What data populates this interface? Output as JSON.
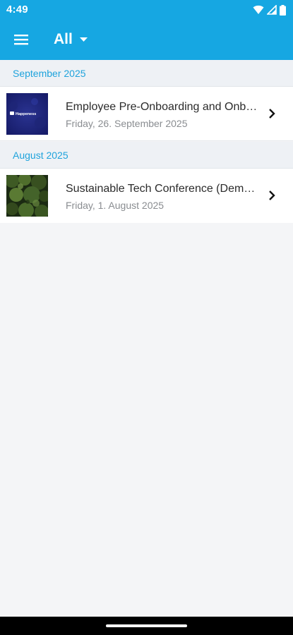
{
  "status_bar": {
    "time": "4:49",
    "icons": [
      "wifi-icon",
      "signal-icon",
      "battery-icon"
    ]
  },
  "toolbar": {
    "menu_icon": "menu-icon",
    "filter_label": "All",
    "filter_icon": "dropdown-arrow-icon"
  },
  "sections": [
    {
      "title": "September 2025",
      "events": [
        {
          "title": "Employee Pre-Onboarding and Onb…",
          "date": "Friday, 26. September 2025",
          "thumbnail_text": "Happeness"
        }
      ]
    },
    {
      "title": "August 2025",
      "events": [
        {
          "title": "Sustainable Tech Conference (Dem…",
          "date": "Friday, 1. August 2025"
        }
      ]
    }
  ],
  "colors": {
    "app_bar": "#16a7e2",
    "section_text": "#1fa3dc",
    "background": "#f4f5f7"
  }
}
